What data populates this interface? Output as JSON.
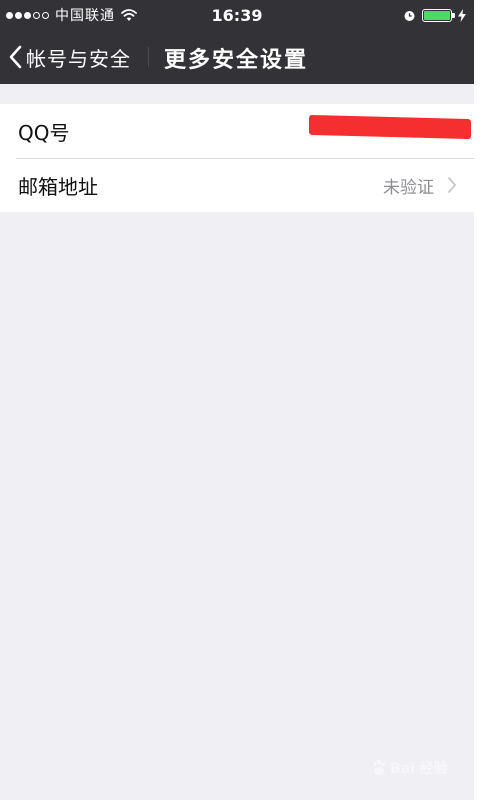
{
  "status_bar": {
    "carrier": "中国联通",
    "time": "16:39",
    "signal_bars_filled": 3,
    "signal_bars_total": 5,
    "icons": [
      "signal-dots-icon",
      "wifi-icon",
      "alarm-icon",
      "battery-icon",
      "charging-bolt-icon"
    ],
    "battery_level": 1.0
  },
  "nav": {
    "back_label": "帐号与安全",
    "title": "更多安全设置"
  },
  "settings": {
    "items": [
      {
        "label": "QQ号",
        "value": "",
        "value_redacted": true,
        "has_chevron": false
      },
      {
        "label": "邮箱地址",
        "value": "未验证",
        "has_chevron": true
      }
    ]
  },
  "watermark": {
    "text": "Bai 经验",
    "icon": "baidu-paw-icon"
  },
  "colors": {
    "nav_background": "#333337",
    "page_background": "#efeff4",
    "row_background": "#ffffff",
    "secondary_text": "#8e8e93",
    "redaction": "#f52f2f",
    "battery_fill": "#4cd964"
  }
}
